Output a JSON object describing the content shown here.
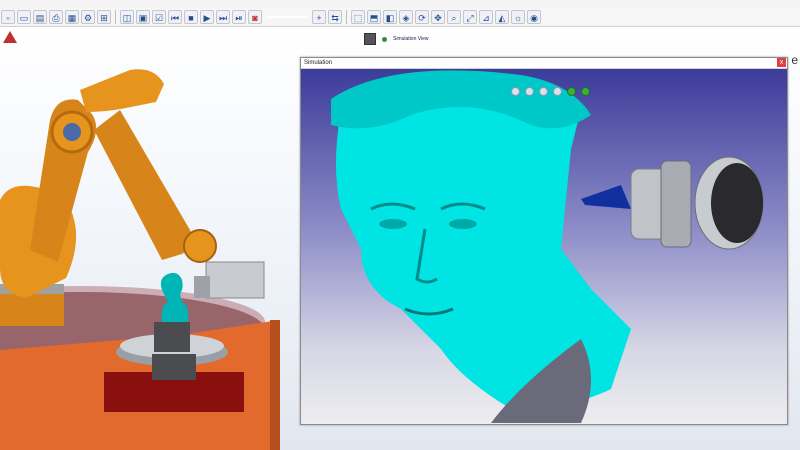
{
  "menu": {
    "text": ""
  },
  "toolbar": {
    "buttons": [
      "⬒",
      "▤",
      "⇄",
      "◧",
      "▦",
      "▣",
      "✓",
      "⊕",
      "⬚",
      "▭",
      "≡",
      "◫",
      "▶",
      "■",
      "▶",
      "⏭",
      "⏮"
    ]
  },
  "main": {
    "corner_label": "e"
  },
  "mini_toolbar": {
    "label": "Simulation View"
  },
  "subwindow": {
    "title": "Simulation",
    "close": "x"
  },
  "colors": {
    "robot": "#e6941e",
    "part": "#00e4e4",
    "table": "#e26a2d",
    "tool": "#c0c4c8"
  }
}
